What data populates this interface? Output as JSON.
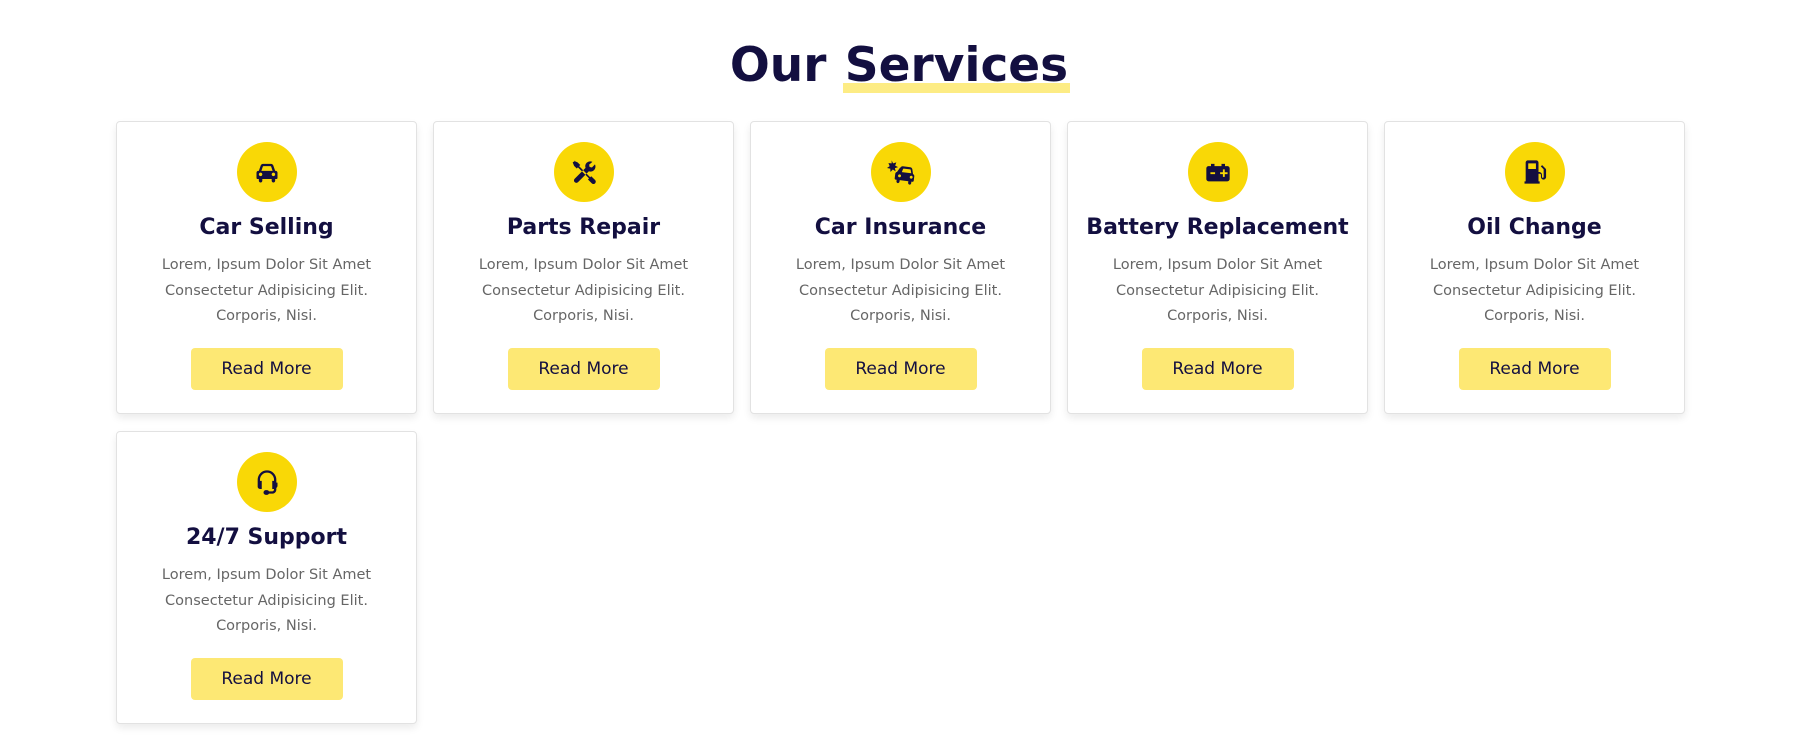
{
  "section": {
    "title_part1": "Our",
    "title_part2": "Services"
  },
  "colors": {
    "accent": "#f9d806",
    "button_bg": "#fde874",
    "heading": "#130f40",
    "text": "#666666"
  },
  "services": [
    {
      "icon": "car-icon",
      "title": "Car Selling",
      "description": "Lorem, Ipsum Dolor Sit Amet Consectetur Adipisicing Elit. Corporis, Nisi.",
      "button": "Read More"
    },
    {
      "icon": "tools-icon",
      "title": "Parts Repair",
      "description": "Lorem, Ipsum Dolor Sit Amet Consectetur Adipisicing Elit. Corporis, Nisi.",
      "button": "Read More"
    },
    {
      "icon": "car-crash-icon",
      "title": "Car Insurance",
      "description": "Lorem, Ipsum Dolor Sit Amet Consectetur Adipisicing Elit. Corporis, Nisi.",
      "button": "Read More"
    },
    {
      "icon": "car-battery-icon",
      "title": "Battery Replacement",
      "description": "Lorem, Ipsum Dolor Sit Amet Consectetur Adipisicing Elit. Corporis, Nisi.",
      "button": "Read More"
    },
    {
      "icon": "gas-pump-icon",
      "title": "Oil Change",
      "description": "Lorem, Ipsum Dolor Sit Amet Consectetur Adipisicing Elit. Corporis, Nisi.",
      "button": "Read More"
    },
    {
      "icon": "headset-icon",
      "title": "24/7 Support",
      "description": "Lorem, Ipsum Dolor Sit Amet Consectetur Adipisicing Elit. Corporis, Nisi.",
      "button": "Read More"
    }
  ]
}
